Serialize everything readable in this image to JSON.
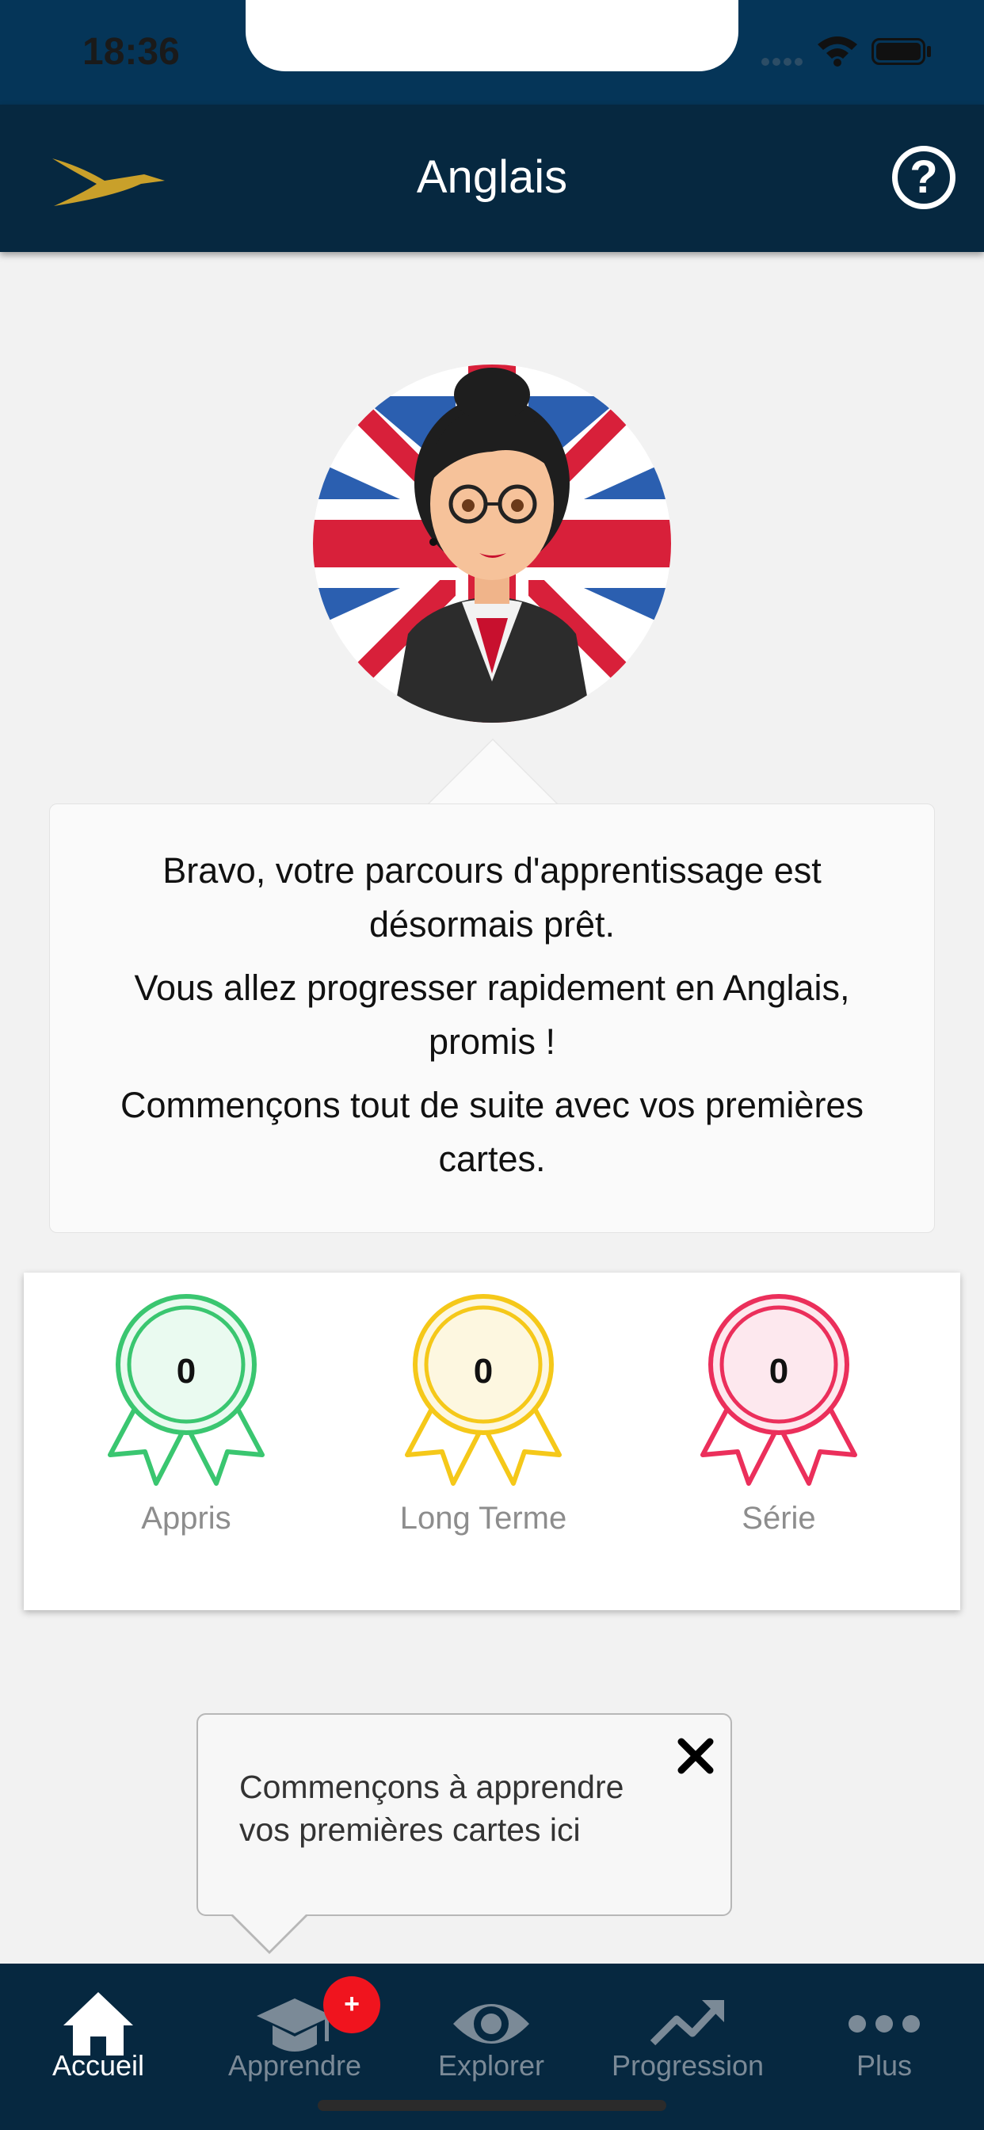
{
  "status_bar": {
    "time": "18:36"
  },
  "header": {
    "title": "Anglais"
  },
  "message": {
    "line1": "Bravo, votre parcours d'apprentissage est désormais prêt.",
    "line2": "Vous allez progresser rapidement en Anglais, promis !",
    "line3": "Commençons tout de suite avec vos premières cartes."
  },
  "stats": [
    {
      "label": "Appris",
      "value": "0",
      "color": "#3ac670",
      "fill": "#eafaf0"
    },
    {
      "label": "Long Terme",
      "value": "0",
      "color": "#f5c819",
      "fill": "#fdf7e0"
    },
    {
      "label": "Série",
      "value": "0",
      "color": "#eb2f5b",
      "fill": "#fde8ee"
    }
  ],
  "tooltip": {
    "text": "Commençons à apprendre vos premières cartes ici"
  },
  "tabs": [
    {
      "label": "Accueil",
      "icon": "home-icon",
      "active": true
    },
    {
      "label": "Apprendre",
      "icon": "graduation-cap-icon",
      "badge": "+"
    },
    {
      "label": "Explorer",
      "icon": "eye-icon"
    },
    {
      "label": "Progression",
      "icon": "trend-up-icon"
    },
    {
      "label": "Plus",
      "icon": "more-dots-icon"
    }
  ]
}
